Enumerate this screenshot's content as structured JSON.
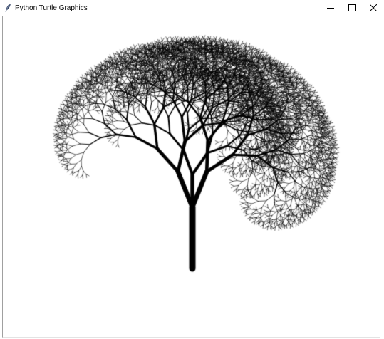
{
  "window": {
    "title": "Python Turtle Graphics",
    "icon": "feather-icon",
    "controls": [
      "minimize-icon",
      "maximize-icon",
      "close-icon"
    ]
  },
  "canvas": {
    "background": "#ffffff",
    "drawing": "fractal-tree",
    "stroke_color": "#000000"
  }
}
